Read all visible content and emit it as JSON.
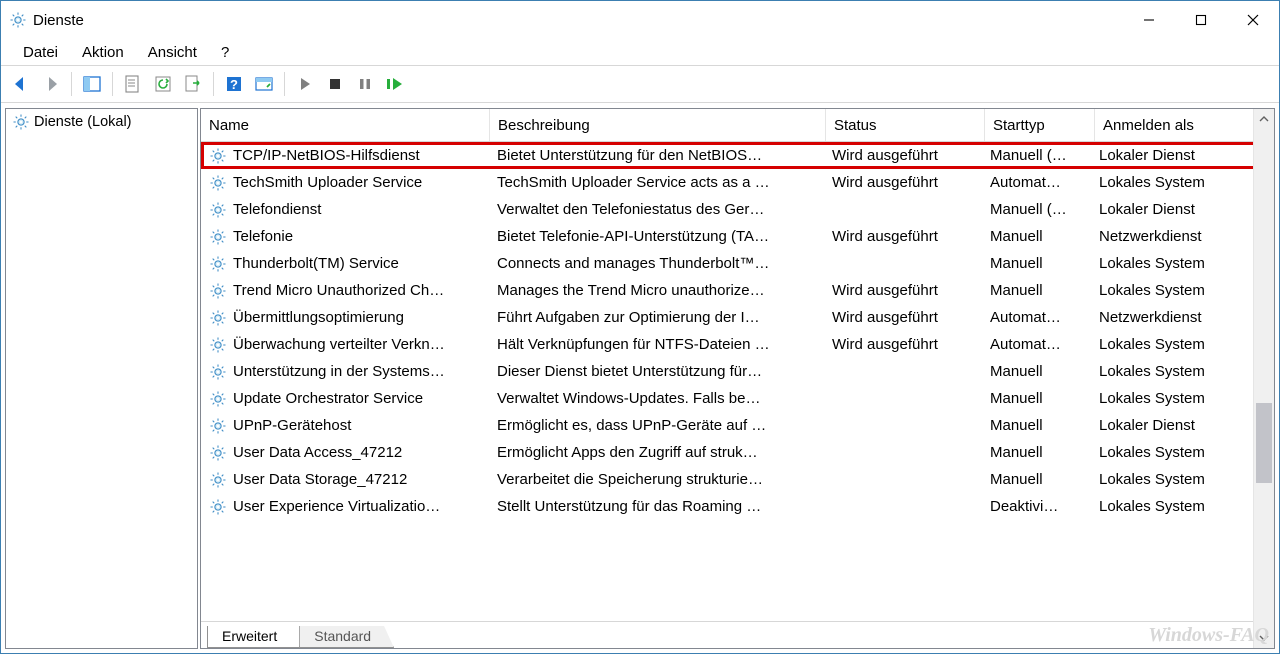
{
  "window": {
    "title": "Dienste"
  },
  "menu": {
    "items": [
      "Datei",
      "Aktion",
      "Ansicht",
      "?"
    ]
  },
  "tree": {
    "label": "Dienste (Lokal)"
  },
  "columns": {
    "name": "Name",
    "desc": "Beschreibung",
    "status": "Status",
    "start": "Starttyp",
    "login": "Anmelden als"
  },
  "rows": [
    {
      "name": "TCP/IP-NetBIOS-Hilfsdienst",
      "desc": "Bietet Unterstützung für den NetBIOS…",
      "status": "Wird ausgeführt",
      "start": "Manuell (…",
      "login": "Lokaler Dienst",
      "highlight": true
    },
    {
      "name": "TechSmith Uploader Service",
      "desc": "TechSmith Uploader Service acts as a …",
      "status": "Wird ausgeführt",
      "start": "Automat…",
      "login": "Lokales System"
    },
    {
      "name": "Telefondienst",
      "desc": "Verwaltet den Telefoniestatus des Ger…",
      "status": "",
      "start": "Manuell (…",
      "login": "Lokaler Dienst"
    },
    {
      "name": "Telefonie",
      "desc": "Bietet Telefonie-API-Unterstützung (TA…",
      "status": "Wird ausgeführt",
      "start": "Manuell",
      "login": "Netzwerkdienst"
    },
    {
      "name": "Thunderbolt(TM) Service",
      "desc": "Connects and manages Thunderbolt™…",
      "status": "",
      "start": "Manuell",
      "login": "Lokales System"
    },
    {
      "name": "Trend Micro Unauthorized Ch…",
      "desc": "Manages the Trend Micro unauthorize…",
      "status": "Wird ausgeführt",
      "start": "Manuell",
      "login": "Lokales System"
    },
    {
      "name": "Übermittlungsoptimierung",
      "desc": "Führt Aufgaben zur Optimierung der I…",
      "status": "Wird ausgeführt",
      "start": "Automat…",
      "login": "Netzwerkdienst"
    },
    {
      "name": "Überwachung verteilter Verkn…",
      "desc": "Hält Verknüpfungen für NTFS-Dateien …",
      "status": "Wird ausgeführt",
      "start": "Automat…",
      "login": "Lokales System"
    },
    {
      "name": "Unterstützung in der Systems…",
      "desc": "Dieser Dienst bietet Unterstützung für…",
      "status": "",
      "start": "Manuell",
      "login": "Lokales System"
    },
    {
      "name": "Update Orchestrator Service",
      "desc": "Verwaltet Windows-Updates. Falls be…",
      "status": "",
      "start": "Manuell",
      "login": "Lokales System"
    },
    {
      "name": "UPnP-Gerätehost",
      "desc": "Ermöglicht es, dass UPnP-Geräte auf …",
      "status": "",
      "start": "Manuell",
      "login": "Lokaler Dienst"
    },
    {
      "name": "User Data Access_47212",
      "desc": "Ermöglicht Apps den Zugriff auf struk…",
      "status": "",
      "start": "Manuell",
      "login": "Lokales System"
    },
    {
      "name": "User Data Storage_47212",
      "desc": "Verarbeitet die Speicherung strukturie…",
      "status": "",
      "start": "Manuell",
      "login": "Lokales System"
    },
    {
      "name": "User Experience Virtualizatio…",
      "desc": "Stellt Unterstützung für das Roaming …",
      "status": "",
      "start": "Deaktivi…",
      "login": "Lokales System"
    }
  ],
  "tabs": {
    "active": "Erweitert",
    "inactive": "Standard"
  },
  "watermark": "Windows-FAQ"
}
